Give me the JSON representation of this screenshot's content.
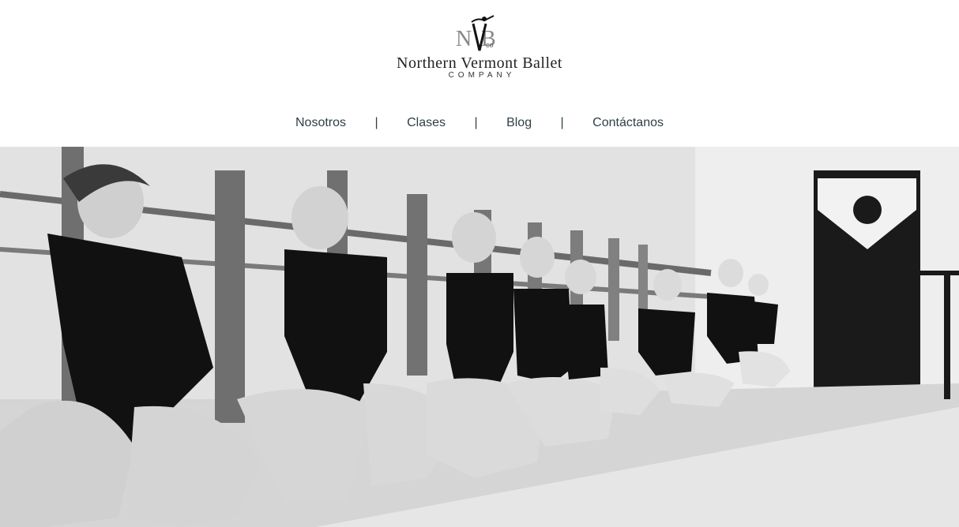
{
  "brand": {
    "monogram": "NVBco",
    "name": "Northern Vermont Ballet",
    "tagline": "COMPANY"
  },
  "nav": {
    "items": [
      {
        "label": "Nosotros"
      },
      {
        "label": "Clases"
      },
      {
        "label": "Blog"
      },
      {
        "label": "Contáctanos"
      }
    ],
    "separator": "|"
  },
  "colors": {
    "nav_text": "#2f3f46",
    "background": "#ffffff"
  }
}
